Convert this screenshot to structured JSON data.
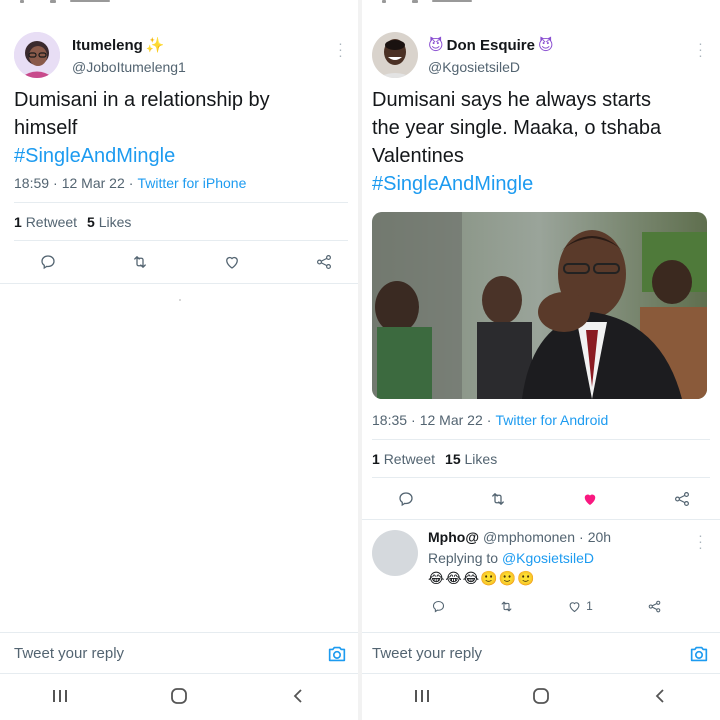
{
  "left_tweet": {
    "name": "Itumeleng",
    "name_emoji": "✨",
    "handle": "@JoboItumeleng1",
    "text": "Dumisani in a relationship by himself",
    "hashtag": "#SingleAndMingle",
    "time": "18:59",
    "date": "12 Mar 22",
    "source": "Twitter for iPhone",
    "retweets": "1",
    "retweets_label": "Retweet",
    "likes": "5",
    "likes_label": "Likes",
    "reply_placeholder": "Tweet your reply"
  },
  "right_tweet": {
    "name_prefix_emoji": "😈",
    "name": "Don Esquire",
    "name_suffix_emoji": "😈",
    "handle": "@KgosietsileD",
    "text_line1": "Dumisani says he always starts",
    "text_line2": "the year single. Maaka, o tshaba",
    "text_line3": "Valentines",
    "hashtag": "#SingleAndMingle",
    "time": "18:35",
    "date": "12 Mar 22",
    "source": "Twitter for Android",
    "retweets": "1",
    "retweets_label": "Retweet",
    "likes": "15",
    "likes_label": "Likes",
    "liked_color": "#f91880",
    "reply": {
      "name": "Mpho@",
      "handle": "@mphomonen",
      "age": "20h",
      "replying_prefix": "Replying to",
      "replying_handle": "@KgosietsileD",
      "emojis": "😂😂😂🙂🙂🙂",
      "like_count": "1"
    },
    "reply_placeholder": "Tweet your reply"
  },
  "colors": {
    "accent": "#1d9bf0",
    "text": "#14171a",
    "muted": "#536471"
  },
  "icons": [
    "more-icon",
    "reply-icon",
    "retweet-icon",
    "heart-icon",
    "share-icon",
    "camera-icon",
    "recents-icon",
    "home-icon",
    "back-icon"
  ]
}
